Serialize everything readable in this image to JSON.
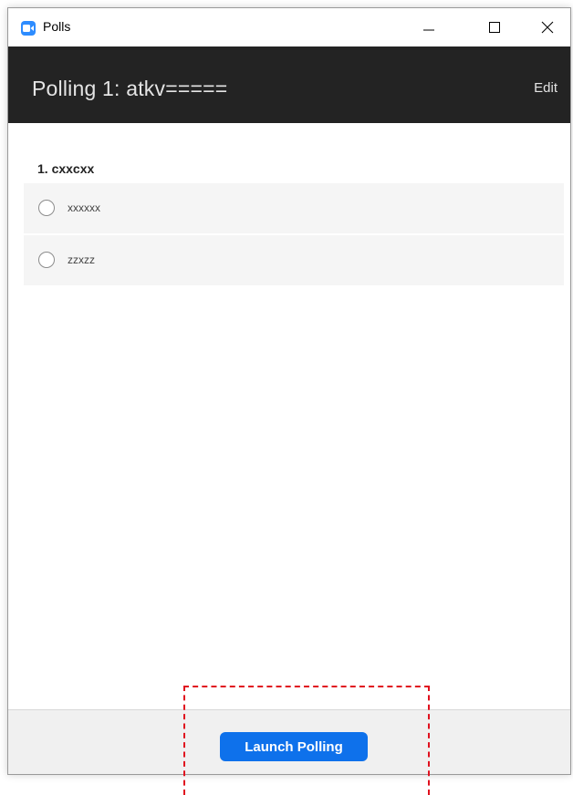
{
  "window": {
    "title": "Polls",
    "app_icon": "zoom-camera-icon",
    "controls": {
      "minimize_icon": "minimize-icon",
      "maximize_icon": "maximize-icon",
      "close_icon": "close-icon"
    }
  },
  "header": {
    "poll_title": "Polling 1: atkv=====",
    "edit_label": "Edit"
  },
  "questions": [
    {
      "title": "1. cxxcxx",
      "options": [
        {
          "label": "xxxxxx"
        },
        {
          "label": "zzxzz"
        }
      ]
    }
  ],
  "footer": {
    "launch_label": "Launch Polling"
  },
  "colors": {
    "header_bg": "#232323",
    "accent": "#0e71eb",
    "highlight": "#e0101e",
    "option_bg": "#f5f5f5",
    "footer_bg": "#f0f0f0"
  }
}
